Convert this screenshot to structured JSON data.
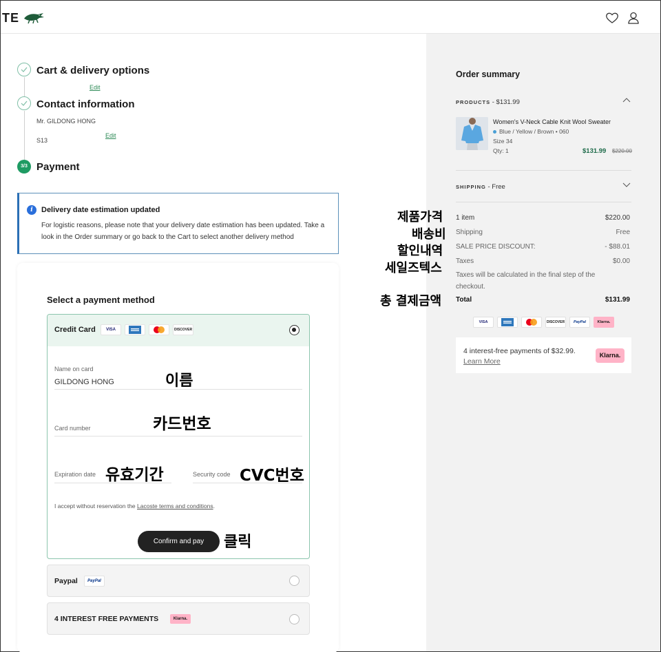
{
  "header": {
    "brand_fragment": "TE",
    "icons": [
      "crocodile-logo-icon",
      "heart-icon",
      "user-icon"
    ]
  },
  "steps": [
    {
      "title": "Cart & delivery options",
      "edit": "Edit",
      "status": "done"
    },
    {
      "title": "Contact information",
      "edit": "Edit",
      "name": "Mr. GILDONG HONG",
      "extra": "S13",
      "status": "done"
    },
    {
      "title": "Payment",
      "badge": "3/3",
      "status": "current"
    }
  ],
  "info": {
    "title": "Delivery date estimation updated",
    "text": "For logistic reasons, please note that your delivery date estimation has been updated. Take a look in the Order summary or go back to the Cart to select another delivery method"
  },
  "payment": {
    "heading": "Select a payment method",
    "credit_card": {
      "label": "Credit Card",
      "logos": [
        "VISA",
        "AMEX",
        "MC",
        "DISCOVER"
      ],
      "name_label": "Name on card",
      "name_value": "GILDONG HONG",
      "card_number_label": "Card number",
      "expiration_label": "Expiration date",
      "security_label": "Security code",
      "terms_prefix": "I accept without reservation the ",
      "terms_link": "Lacoste terms and conditions",
      "terms_suffix": ".",
      "confirm": "Confirm and pay"
    },
    "paypal": {
      "label": "Paypal",
      "logo": "PayPal"
    },
    "klarna": {
      "label": "4 INTEREST FREE PAYMENTS",
      "logo": "Klarna."
    }
  },
  "annotations": {
    "name": "이름",
    "card_number": "카드번호",
    "expiration": "유효기간",
    "cvc": "CVC번호",
    "click": "클릭",
    "product_price": "제품가격",
    "shipping": "배송비",
    "discount": "할인내역",
    "sales_tax": "세일즈텍스",
    "total": "총 결제금액"
  },
  "summary": {
    "title": "Order summary",
    "products_label": "PRODUCTS",
    "products_total": " - $131.99",
    "product": {
      "name": "Women's V-Neck Cable Knit Wool Sweater",
      "color": "Blue / Yellow / Brown • 060",
      "size": "Size 34",
      "qty": "Qty: 1",
      "price": "$131.99",
      "old_price": "$220.00"
    },
    "shipping_label": "SHIPPING",
    "shipping_value": " - Free",
    "rows": {
      "items_label": "1 item",
      "items_value": "$220.00",
      "shipping_label": "Shipping",
      "shipping_value": "Free",
      "discount_label": "SALE PRICE DISCOUNT:",
      "discount_value": "- $88.01",
      "taxes_label": "Taxes",
      "taxes_value": "$0.00",
      "taxes_note": "Taxes will be calculated in the final step of the checkout.",
      "total_label": "Total",
      "total_value": "$131.99"
    },
    "payment_logos": [
      "VISA",
      "AMEX",
      "MC",
      "DISCOVER",
      "PayPal",
      "Klarna."
    ],
    "klarna_text": "4 interest-free payments of $32.99.",
    "klarna_more": "Learn More",
    "klarna_badge": "Klarna."
  },
  "colors": {
    "accent_green": "#1e9b63",
    "klarna_pink": "#ffb3c7",
    "info_blue": "#2a6fdb"
  }
}
